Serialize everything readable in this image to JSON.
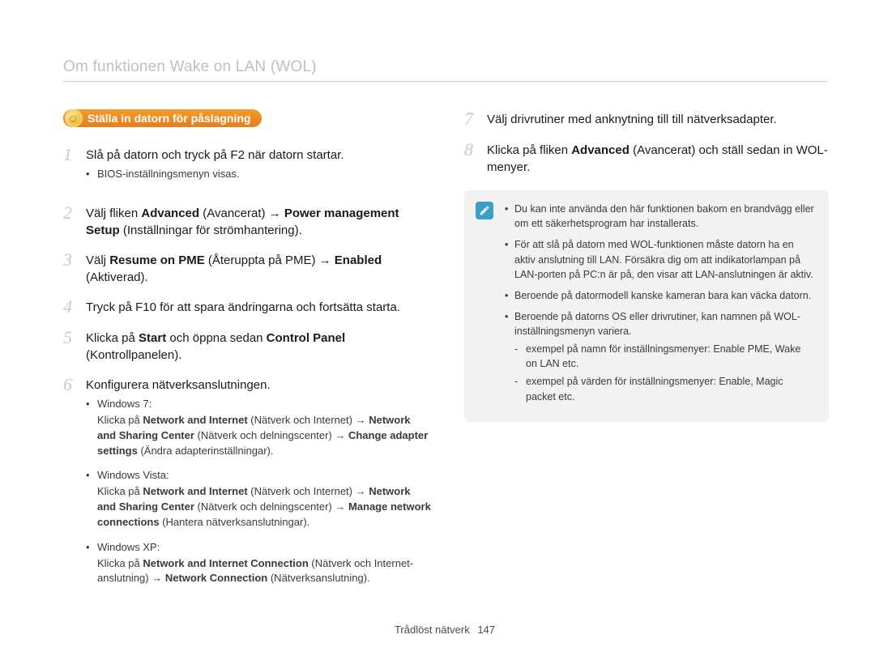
{
  "page_title": "Om funktionen Wake on LAN (WOL)",
  "callout_label": "Ställa in datorn för påslagning",
  "left_steps": [
    {
      "n": "1",
      "html": "Slå på datorn och tryck på F2 när datorn startar.",
      "sub": [
        {
          "os": "",
          "desc": "BIOS-inställningsmenyn visas."
        }
      ]
    },
    {
      "n": "2",
      "html": "Välj fliken <b>Advanced</b> (Avancerat) → <b>Power management Setup</b> (Inställningar för strömhantering)."
    },
    {
      "n": "3",
      "html": "Välj <b>Resume on PME</b> (Återuppta på PME) → <b>Enabled</b> (Aktiverad)."
    },
    {
      "n": "4",
      "html": "Tryck på F10 för att spara ändringarna och fortsätta starta."
    },
    {
      "n": "5",
      "html": "Klicka på <b>Start</b> och öppna sedan <b>Control Panel</b> (Kontrollpanelen)."
    },
    {
      "n": "6",
      "html": "Konfigurera nätverksanslutningen.",
      "sub": [
        {
          "os": "Windows 7:",
          "desc": "Klicka på <b>Network and Internet</b> (Nätverk och Internet) → <b>Network and Sharing Center</b> (Nätverk och delningscenter) → <b>Change adapter settings</b> (Ändra adapterinställningar)."
        },
        {
          "os": "Windows Vista:",
          "desc": "Klicka på <b>Network and Internet</b> (Nätverk och Internet) → <b>Network and Sharing Center</b> (Nätverk och delningscenter) → <b>Manage network connections</b> (Hantera nätverksanslutningar)."
        },
        {
          "os": "Windows XP:",
          "desc": "Klicka på <b>Network and Internet Connection</b> (Nätverk och Internet-anslutning) → <b>Network Connection</b> (Nätverksanslutning)."
        }
      ]
    }
  ],
  "right_steps": [
    {
      "n": "7",
      "html": "Välj drivrutiner med anknytning till till nätverksadapter."
    },
    {
      "n": "8",
      "html": "Klicka på fliken <b>Advanced</b> (Avancerat) och ställ sedan in WOL-menyer."
    }
  ],
  "notes": [
    {
      "text": "Du kan inte använda den här funktionen bakom en brandvägg eller om ett säkerhetsprogram har installerats."
    },
    {
      "text": "För att slå på datorn med WOL-funktionen måste datorn ha en aktiv anslutning till LAN. Försäkra dig om att indikatorlampan på LAN-porten på PC:n är på, den visar att LAN-anslutningen är aktiv."
    },
    {
      "text": "Beroende på datormodell kanske kameran bara kan väcka datorn."
    },
    {
      "text": "Beroende på datorns OS eller drivrutiner, kan namnen på WOL-inställningsmenyn variera.",
      "sub": [
        "exempel på namn för inställningsmenyer: Enable PME, Wake on LAN etc.",
        "exempel på värden för inställningsmenyer: Enable, Magic packet etc."
      ]
    }
  ],
  "footer_section": "Trådlöst nätverk",
  "footer_page": "147"
}
